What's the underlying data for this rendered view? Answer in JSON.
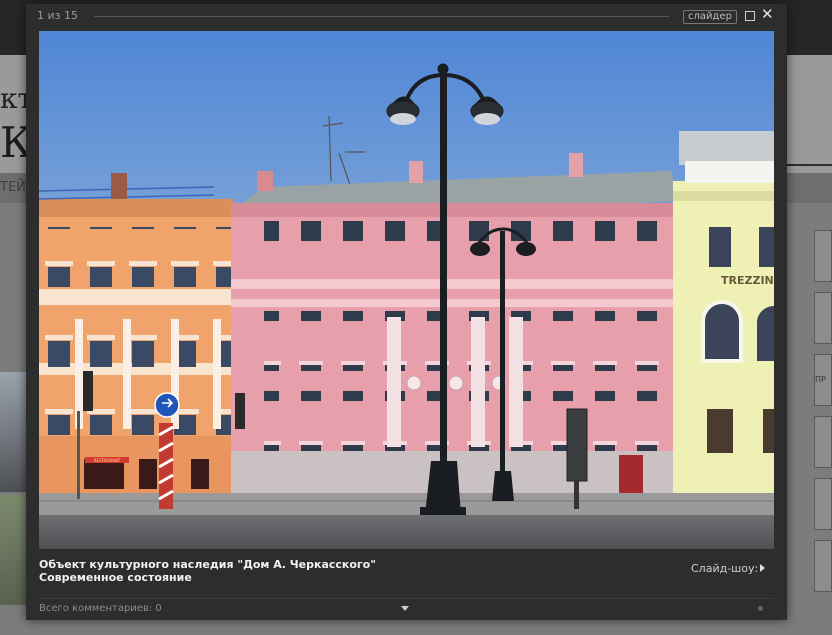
{
  "background": {
    "heading_fragment": "кту",
    "heading_fragment_2": "КА",
    "menu_fragment": "ТЕЙ",
    "thumb_label": "ПР"
  },
  "lightbox": {
    "counter": "1 из 15",
    "slider_label": "слайдер",
    "maximize_icon": "maximize-icon",
    "close_icon": "close-icon",
    "close_glyph": "✕",
    "photo_description_icon": "building-photo",
    "caption": "Объект культурного наследия \"Дом А. Черкасского\" Современное состояние",
    "slideshow_label": "Слайд-шоу:",
    "comments_label": "Всего комментариев: 0",
    "photo_signs": {
      "restaurant_sign": "RESTAURANT",
      "shop_sign": "TREZZINI"
    }
  },
  "colors": {
    "lightbox_bg": "#2d2d2d",
    "sky": "#5f8fd3",
    "orange_building": "#f2a86e",
    "pink_building": "#e9a0ad",
    "yellow_building": "#eef0b5"
  }
}
